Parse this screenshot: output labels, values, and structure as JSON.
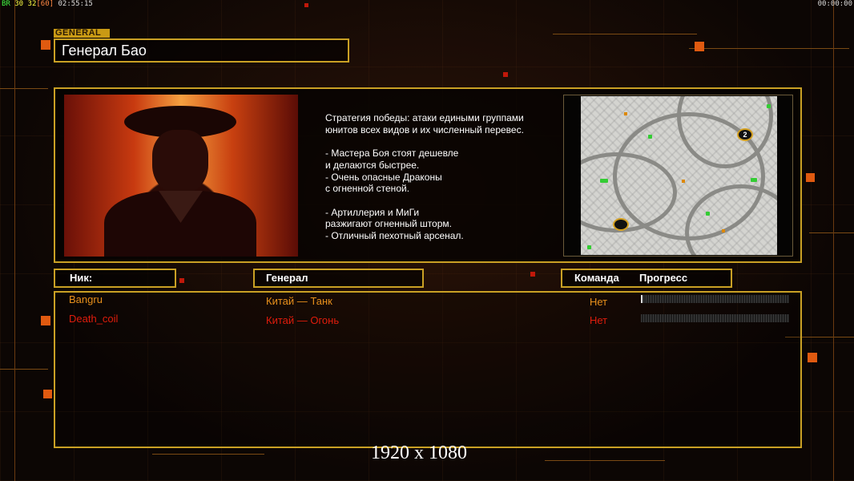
{
  "hud": {
    "fps_prefix": "BR",
    "fps_a": "30",
    "fps_b": "32",
    "fps_c": "[60]",
    "clock": "02:55:15",
    "timer": "00:00:00"
  },
  "header": {
    "section_tag": "GENERAL",
    "title": "Генерал Бао"
  },
  "general_info": {
    "description": "Стратегия победы: атаки едиными группами\nюнитов всех видов и их численный перевес.\n\n- Мастера Боя стоят дешевле\nи делаются быстрее.\n- Очень опасные Драконы\nс огненной стеной.\n\n- Артиллерия и МиГи\nразжигают огненный шторм.\n- Отличный пехотный арсенал."
  },
  "map": {
    "start_marker": "2"
  },
  "columns": {
    "nick": "Ник:",
    "general": "Генерал",
    "team": "Команда",
    "progress": "Прогресс"
  },
  "players": [
    {
      "nick": "Bangru",
      "general": "Китай — Танк",
      "team": "Нет",
      "progress": 0.01,
      "color": "#e8901c"
    },
    {
      "nick": "Death_coil",
      "general": "Китай — Огонь",
      "team": "Нет",
      "progress": 0.0,
      "color": "#e01c0c"
    }
  ],
  "watermark": "1920 x 1080",
  "colors": {
    "frame": "#c9a024",
    "accent": "#e05a10"
  }
}
